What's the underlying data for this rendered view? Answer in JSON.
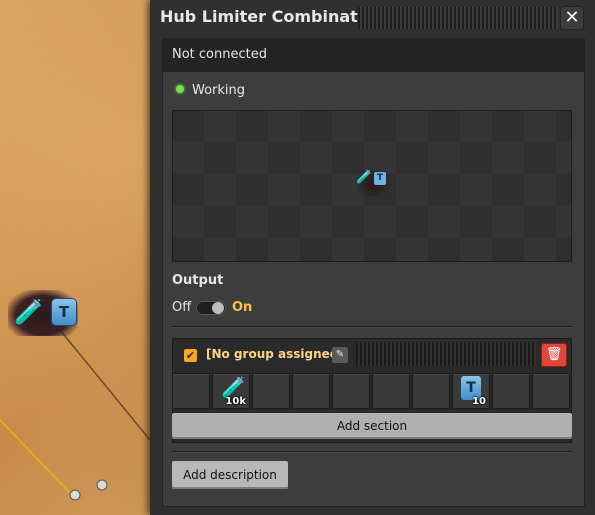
{
  "window": {
    "title": "Hub Limiter Combinator",
    "close_label": "✕",
    "connection_status": "Not connected",
    "entity_status": "Working"
  },
  "preview": {
    "entity_icons": [
      "science-pack-icon",
      "t-signal-icon"
    ],
    "entity_t_letter": "T"
  },
  "output": {
    "label": "Output",
    "switch_off": "Off",
    "switch_on": "On",
    "state": "On"
  },
  "section": {
    "checked": true,
    "group_name": "[No group assigned]",
    "edit_icon": "pencil-icon",
    "delete_icon": "trash-icon",
    "slots": [
      {
        "item": "",
        "count": ""
      },
      {
        "item": "science-pack",
        "count": "10k"
      },
      {
        "item": "",
        "count": ""
      },
      {
        "item": "",
        "count": ""
      },
      {
        "item": "",
        "count": ""
      },
      {
        "item": "",
        "count": ""
      },
      {
        "item": "",
        "count": ""
      },
      {
        "item": "t-signal",
        "label": "T",
        "count": "10"
      },
      {
        "item": "",
        "count": ""
      },
      {
        "item": "",
        "count": ""
      }
    ],
    "add_section_label": "Add section"
  },
  "footer": {
    "add_description_label": "Add description"
  },
  "world": {
    "entity_t_letter": "T"
  },
  "colors": {
    "accent_orange": "#f6a623",
    "status_green": "#6fe14a",
    "delete_red": "#e0463c",
    "on_label": "#ffc03a"
  }
}
